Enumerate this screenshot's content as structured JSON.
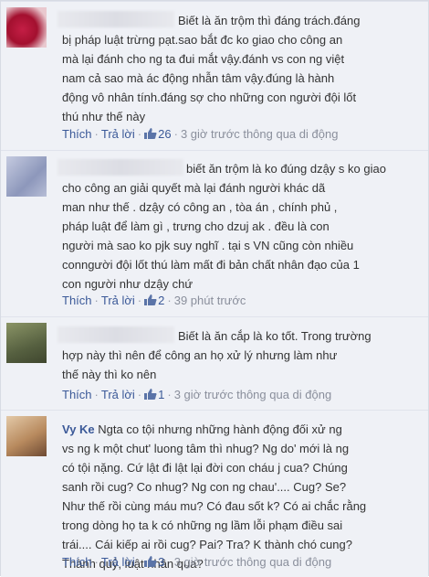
{
  "comments": [
    {
      "author": "",
      "text": "Biết là ăn trộm thì đáng trách.đáng\nbị pháp luật trừng pạt.sao bắt đc ko giao cho công an\nmà lại đánh cho ng ta đui mắt vậy.đánh vs con ng việt\nnam cả sao mà ác động nhẫn tâm vậy.đúng là hành\nđộng vô nhân tính.đáng sợ cho những con người đội lốt\nthú như thế này",
      "like_label": "Thích",
      "reply_label": "Trả lời",
      "likes": "26",
      "time": "3 giờ trước thông qua di động",
      "avatar_color": "#b0183a"
    },
    {
      "author": "",
      "text": "biết ăn trộm là ko đúng dzậy s ko giao\ncho công an giải quyết mà lại đánh người khác dã\nman như thế . dzậy có công an , tòa án , chính phủ ,\npháp luật để làm gì , trưng cho dzuj ak . đều là con\nngười mà sao ko pjk suy nghĩ . tại s VN cũng còn nhiều\nconngười đội lốt thú làm mất đi bản chất nhân đạo của 1\ncon người như dzậy chứ",
      "like_label": "Thích",
      "reply_label": "Trả lời",
      "likes": "2",
      "time": "39 phút trước",
      "avatar_color": "#9aa3c4"
    },
    {
      "author": "",
      "text": "Biết là ăn cắp là ko tốt. Trong trường\nhợp này thì nên để công an họ xử lý nhưng làm như\nthế này thì ko nên",
      "like_label": "Thích",
      "reply_label": "Trả lời",
      "likes": "1",
      "time": "3 giờ trước thông qua di động",
      "avatar_color": "#6f7a52"
    },
    {
      "author": "Vy Ke",
      "text": "Ngta co tội nhưng những hành động đối xử ng\nvs ng k một chut' luong tâm thì nhug? Ng do' mới là ng\ncó tội nặng. Cứ lật đi lật lại đời con cháu j cua? Chúng\nsanh rồi cug? Co nhug? Ng con ng chau'.... Cug? Se?\nNhư thế rồi cùng máu mu? Có đau sốt k? Có ai chắc rằng\ntrong dòng họ ta k có những ng lầm lỗi phạm điều sai\ntrái.... Cái kiếp ai rồi cug? Pai? Tra? K thành chó cung?\nThành quỷ, luật nhân qua?",
      "like_label": "Thích",
      "reply_label": "Trả lời",
      "likes": "3",
      "time": "3 giờ trước thông qua di động",
      "avatar_color": "#c9a37a"
    }
  ]
}
